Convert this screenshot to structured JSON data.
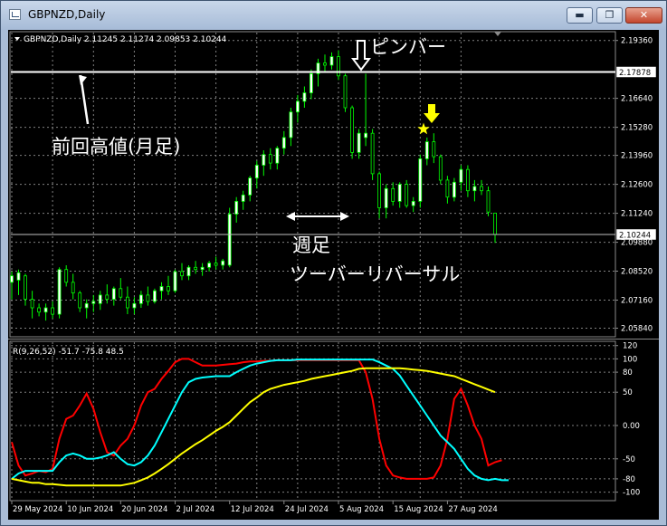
{
  "window": {
    "title": "GBPNZD,Daily"
  },
  "window_controls": {
    "minimize": "▬",
    "maximize": "❐",
    "close": "✕"
  },
  "chart_data": [
    {
      "type": "candlestick",
      "info": "GBPNZD,Daily  2.11245 2.11274 2.09853 2.10244",
      "ylim": [
        2.0548,
        2.1973
      ],
      "y_ticks": [
        2.1936,
        2.1664,
        2.1528,
        2.1396,
        2.126,
        2.1124,
        2.0988,
        2.0852,
        2.0716,
        2.0584
      ],
      "y_tick_labels": [
        "2.19360",
        "2.16640",
        "2.15280",
        "2.13960",
        "2.12600",
        "2.11240",
        "2.09880",
        "2.08520",
        "2.07160",
        "2.05840"
      ],
      "price_lines": [
        {
          "value": 2.17878,
          "label": "2.17878",
          "color": "#ffffff"
        },
        {
          "value": 2.10244,
          "label": "2.10244",
          "color": "#c0c0c0"
        }
      ],
      "x_labels": [
        "29 May 2024",
        "10 Jun 2024",
        "20 Jun 2024",
        "2 Jul 2024",
        "12 Jul 2024",
        "24 Jul 2024",
        "5 Aug 2024",
        "15 Aug 2024",
        "27 Aug 2024"
      ],
      "candles": [
        {
          "o": 2.08,
          "h": 2.085,
          "l": 2.072,
          "c": 2.083
        },
        {
          "o": 2.081,
          "h": 2.086,
          "l": 2.074,
          "c": 2.0845
        },
        {
          "o": 2.083,
          "h": 2.084,
          "l": 2.069,
          "c": 2.072
        },
        {
          "o": 2.072,
          "h": 2.076,
          "l": 2.063,
          "c": 2.068
        },
        {
          "o": 2.068,
          "h": 2.07,
          "l": 2.064,
          "c": 2.066
        },
        {
          "o": 2.066,
          "h": 2.07,
          "l": 2.062,
          "c": 2.068
        },
        {
          "o": 2.068,
          "h": 2.071,
          "l": 2.063,
          "c": 2.065
        },
        {
          "o": 2.065,
          "h": 2.087,
          "l": 2.063,
          "c": 2.086
        },
        {
          "o": 2.086,
          "h": 2.088,
          "l": 2.078,
          "c": 2.08
        },
        {
          "o": 2.08,
          "h": 2.084,
          "l": 2.072,
          "c": 2.075
        },
        {
          "o": 2.075,
          "h": 2.076,
          "l": 2.066,
          "c": 2.068
        },
        {
          "o": 2.068,
          "h": 2.072,
          "l": 2.063,
          "c": 2.07
        },
        {
          "o": 2.07,
          "h": 2.074,
          "l": 2.066,
          "c": 2.071
        },
        {
          "o": 2.07,
          "h": 2.076,
          "l": 2.067,
          "c": 2.074
        },
        {
          "o": 2.074,
          "h": 2.079,
          "l": 2.07,
          "c": 2.072
        },
        {
          "o": 2.072,
          "h": 2.078,
          "l": 2.069,
          "c": 2.077
        },
        {
          "o": 2.077,
          "h": 2.082,
          "l": 2.072,
          "c": 2.073
        },
        {
          "o": 2.073,
          "h": 2.078,
          "l": 2.065,
          "c": 2.068
        },
        {
          "o": 2.068,
          "h": 2.073,
          "l": 2.065,
          "c": 2.07
        },
        {
          "o": 2.07,
          "h": 2.076,
          "l": 2.068,
          "c": 2.074
        },
        {
          "o": 2.074,
          "h": 2.078,
          "l": 2.069,
          "c": 2.071
        },
        {
          "o": 2.071,
          "h": 2.077,
          "l": 2.07,
          "c": 2.076
        },
        {
          "o": 2.076,
          "h": 2.08,
          "l": 2.072,
          "c": 2.078
        },
        {
          "o": 2.078,
          "h": 2.083,
          "l": 2.074,
          "c": 2.076
        },
        {
          "o": 2.076,
          "h": 2.086,
          "l": 2.075,
          "c": 2.085
        },
        {
          "o": 2.085,
          "h": 2.089,
          "l": 2.081,
          "c": 2.083
        },
        {
          "o": 2.083,
          "h": 2.088,
          "l": 2.081,
          "c": 2.087
        },
        {
          "o": 2.087,
          "h": 2.09,
          "l": 2.084,
          "c": 2.086
        },
        {
          "o": 2.086,
          "h": 2.089,
          "l": 2.083,
          "c": 2.087
        },
        {
          "o": 2.087,
          "h": 2.09,
          "l": 2.085,
          "c": 2.089
        },
        {
          "o": 2.089,
          "h": 2.092,
          "l": 2.086,
          "c": 2.088
        },
        {
          "o": 2.088,
          "h": 2.091,
          "l": 2.086,
          "c": 2.09
        },
        {
          "o": 2.088,
          "h": 2.115,
          "l": 2.087,
          "c": 2.112
        },
        {
          "o": 2.112,
          "h": 2.12,
          "l": 2.108,
          "c": 2.118
        },
        {
          "o": 2.118,
          "h": 2.123,
          "l": 2.114,
          "c": 2.121
        },
        {
          "o": 2.121,
          "h": 2.13,
          "l": 2.118,
          "c": 2.129
        },
        {
          "o": 2.129,
          "h": 2.137,
          "l": 2.124,
          "c": 2.135
        },
        {
          "o": 2.135,
          "h": 2.142,
          "l": 2.13,
          "c": 2.14
        },
        {
          "o": 2.14,
          "h": 2.143,
          "l": 2.133,
          "c": 2.136
        },
        {
          "o": 2.136,
          "h": 2.144,
          "l": 2.133,
          "c": 2.143
        },
        {
          "o": 2.143,
          "h": 2.151,
          "l": 2.14,
          "c": 2.148
        },
        {
          "o": 2.148,
          "h": 2.162,
          "l": 2.144,
          "c": 2.16
        },
        {
          "o": 2.16,
          "h": 2.168,
          "l": 2.155,
          "c": 2.165
        },
        {
          "o": 2.165,
          "h": 2.172,
          "l": 2.162,
          "c": 2.169
        },
        {
          "o": 2.169,
          "h": 2.18,
          "l": 2.166,
          "c": 2.178
        },
        {
          "o": 2.178,
          "h": 2.185,
          "l": 2.172,
          "c": 2.183
        },
        {
          "o": 2.183,
          "h": 2.187,
          "l": 2.179,
          "c": 2.182
        },
        {
          "o": 2.182,
          "h": 2.188,
          "l": 2.18,
          "c": 2.186
        },
        {
          "o": 2.186,
          "h": 2.189,
          "l": 2.175,
          "c": 2.177
        },
        {
          "o": 2.177,
          "h": 2.178,
          "l": 2.16,
          "c": 2.162
        },
        {
          "o": 2.162,
          "h": 2.163,
          "l": 2.138,
          "c": 2.141
        },
        {
          "o": 2.141,
          "h": 2.152,
          "l": 2.138,
          "c": 2.15
        },
        {
          "o": 2.148,
          "h": 2.178,
          "l": 2.144,
          "c": 2.15
        },
        {
          "o": 2.15,
          "h": 2.152,
          "l": 2.128,
          "c": 2.131
        },
        {
          "o": 2.131,
          "h": 2.132,
          "l": 2.11,
          "c": 2.115
        },
        {
          "o": 2.115,
          "h": 2.126,
          "l": 2.11,
          "c": 2.124
        },
        {
          "o": 2.124,
          "h": 2.127,
          "l": 2.116,
          "c": 2.118
        },
        {
          "o": 2.118,
          "h": 2.127,
          "l": 2.115,
          "c": 2.126
        },
        {
          "o": 2.126,
          "h": 2.128,
          "l": 2.115,
          "c": 2.116
        },
        {
          "o": 2.116,
          "h": 2.12,
          "l": 2.113,
          "c": 2.118
        },
        {
          "o": 2.118,
          "h": 2.14,
          "l": 2.115,
          "c": 2.138
        },
        {
          "o": 2.138,
          "h": 2.148,
          "l": 2.135,
          "c": 2.146
        },
        {
          "o": 2.146,
          "h": 2.15,
          "l": 2.136,
          "c": 2.139
        },
        {
          "o": 2.139,
          "h": 2.14,
          "l": 2.126,
          "c": 2.128
        },
        {
          "o": 2.128,
          "h": 2.13,
          "l": 2.117,
          "c": 2.12
        },
        {
          "o": 2.12,
          "h": 2.129,
          "l": 2.118,
          "c": 2.127
        },
        {
          "o": 2.127,
          "h": 2.135,
          "l": 2.123,
          "c": 2.133
        },
        {
          "o": 2.133,
          "h": 2.135,
          "l": 2.12,
          "c": 2.123
        },
        {
          "o": 2.123,
          "h": 2.128,
          "l": 2.118,
          "c": 2.125
        },
        {
          "o": 2.125,
          "h": 2.128,
          "l": 2.121,
          "c": 2.123
        },
        {
          "o": 2.123,
          "h": 2.125,
          "l": 2.111,
          "c": 2.113
        },
        {
          "o": 2.1125,
          "h": 2.1127,
          "l": 2.0985,
          "c": 2.1024
        }
      ]
    },
    {
      "type": "line",
      "info": "R(9,26,52) -51.7 -75.8 48.5",
      "ylim": [
        -110,
        125
      ],
      "y_ticks": [
        120,
        100,
        80,
        50,
        0,
        -50,
        -80,
        -100
      ],
      "y_tick_labels": [
        "120",
        "100",
        "80",
        "50",
        "0.00",
        "-50",
        "-80",
        "-100"
      ],
      "series": [
        {
          "color": "#ff0000",
          "values": [
            -25,
            -60,
            -75,
            -72,
            -68,
            -70,
            -65,
            -20,
            10,
            15,
            30,
            48,
            25,
            -10,
            -40,
            -45,
            -30,
            -20,
            0,
            30,
            50,
            55,
            70,
            82,
            95,
            100,
            100,
            95,
            90,
            90,
            90,
            91,
            92,
            93,
            95,
            96,
            96,
            97,
            97,
            98,
            98,
            98,
            98,
            98,
            98,
            98,
            98,
            98,
            98,
            98,
            98,
            98,
            80,
            40,
            -20,
            -60,
            -75,
            -78,
            -80,
            -80,
            -80,
            -80,
            -78,
            -60,
            -20,
            40,
            55,
            30,
            0,
            -20,
            -60,
            -55,
            -52
          ]
        },
        {
          "color": "#00ffff",
          "values": [
            -80,
            -72,
            -68,
            -68,
            -68,
            -68,
            -68,
            -55,
            -45,
            -42,
            -45,
            -50,
            -50,
            -48,
            -45,
            -40,
            -50,
            -58,
            -60,
            -55,
            -45,
            -30,
            -10,
            10,
            30,
            50,
            65,
            70,
            72,
            73,
            74,
            74,
            74,
            80,
            85,
            90,
            93,
            95,
            97,
            98,
            98,
            98,
            99,
            99,
            99,
            99,
            99,
            99,
            99,
            99,
            99,
            99,
            99,
            99,
            95,
            90,
            85,
            75,
            60,
            45,
            30,
            15,
            0,
            -15,
            -25,
            -35,
            -50,
            -65,
            -75,
            -80,
            -82,
            -80,
            -82,
            -82
          ]
        },
        {
          "color": "#ffff00",
          "values": [
            -80,
            -82,
            -84,
            -86,
            -86,
            -88,
            -88,
            -89,
            -90,
            -90,
            -90,
            -90,
            -90,
            -90,
            -90,
            -90,
            -90,
            -88,
            -86,
            -82,
            -78,
            -72,
            -65,
            -58,
            -50,
            -42,
            -35,
            -28,
            -22,
            -15,
            -8,
            -2,
            5,
            15,
            25,
            35,
            42,
            50,
            55,
            58,
            61,
            63,
            65,
            67,
            70,
            72,
            74,
            76,
            78,
            80,
            82,
            85,
            86,
            86,
            86,
            86,
            86,
            86,
            85,
            84,
            83,
            82,
            80,
            78,
            76,
            74,
            70,
            66,
            62,
            58,
            54,
            50
          ]
        }
      ]
    }
  ],
  "annotations": {
    "monthly_high": "前回高値(月足)",
    "pinbar": "ピンバー",
    "weekly_label": "週足",
    "weekly_subtitle": "ツーバーリバーサル"
  }
}
